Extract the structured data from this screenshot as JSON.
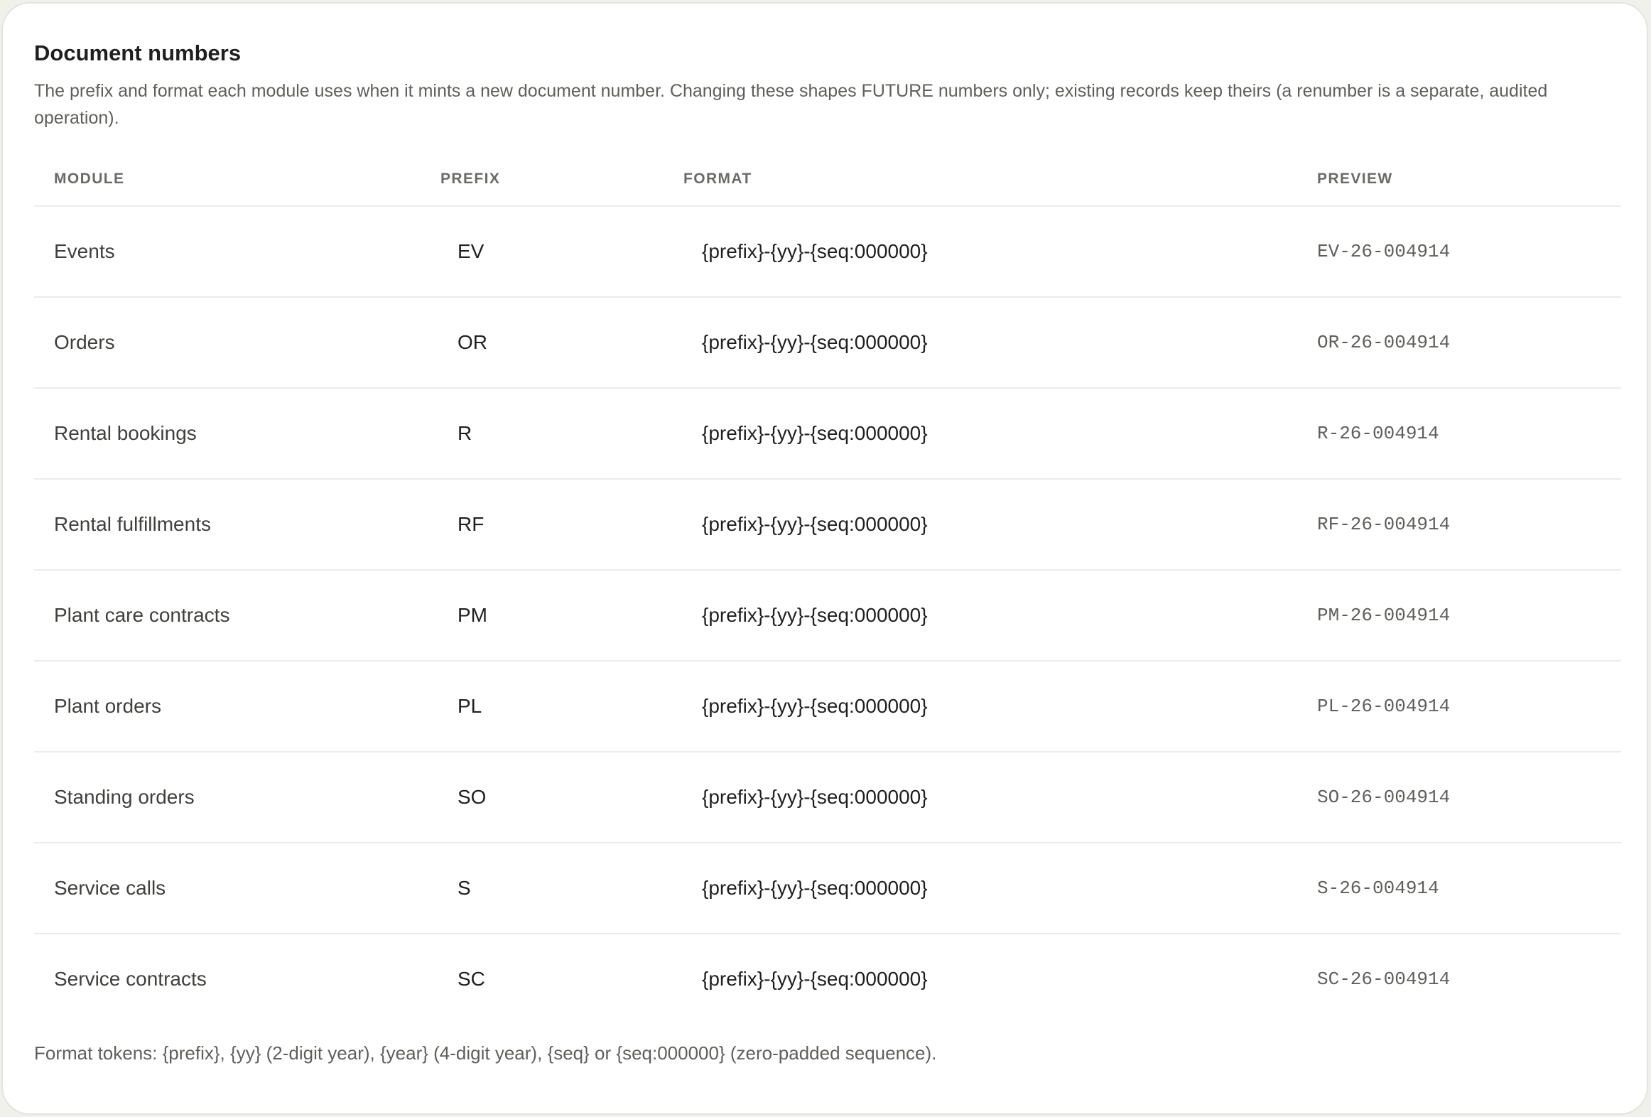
{
  "section": {
    "title": "Document numbers",
    "description": "The prefix and format each module uses when it mints a new document number. Changing these shapes FUTURE numbers only; existing records keep theirs (a renumber is a separate, audited operation)."
  },
  "table": {
    "headers": {
      "module": "MODULE",
      "prefix": "PREFIX",
      "format": "FORMAT",
      "preview": "PREVIEW"
    },
    "rows": [
      {
        "module": "Events",
        "prefix": "EV",
        "format": "{prefix}-{yy}-{seq:000000}",
        "preview": "EV-26-004914"
      },
      {
        "module": "Orders",
        "prefix": "OR",
        "format": "{prefix}-{yy}-{seq:000000}",
        "preview": "OR-26-004914"
      },
      {
        "module": "Rental bookings",
        "prefix": "R",
        "format": "{prefix}-{yy}-{seq:000000}",
        "preview": "R-26-004914"
      },
      {
        "module": "Rental fulfillments",
        "prefix": "RF",
        "format": "{prefix}-{yy}-{seq:000000}",
        "preview": "RF-26-004914"
      },
      {
        "module": "Plant care contracts",
        "prefix": "PM",
        "format": "{prefix}-{yy}-{seq:000000}",
        "preview": "PM-26-004914"
      },
      {
        "module": "Plant orders",
        "prefix": "PL",
        "format": "{prefix}-{yy}-{seq:000000}",
        "preview": "PL-26-004914"
      },
      {
        "module": "Standing orders",
        "prefix": "SO",
        "format": "{prefix}-{yy}-{seq:000000}",
        "preview": "SO-26-004914"
      },
      {
        "module": "Service calls",
        "prefix": "S",
        "format": "{prefix}-{yy}-{seq:000000}",
        "preview": "S-26-004914"
      },
      {
        "module": "Service contracts",
        "prefix": "SC",
        "format": "{prefix}-{yy}-{seq:000000}",
        "preview": "SC-26-004914"
      }
    ]
  },
  "footnote": "Format tokens: {prefix}, {yy} (2-digit year), {year} (4-digit year), {seq} or {seq:000000} (zero-padded sequence)."
}
